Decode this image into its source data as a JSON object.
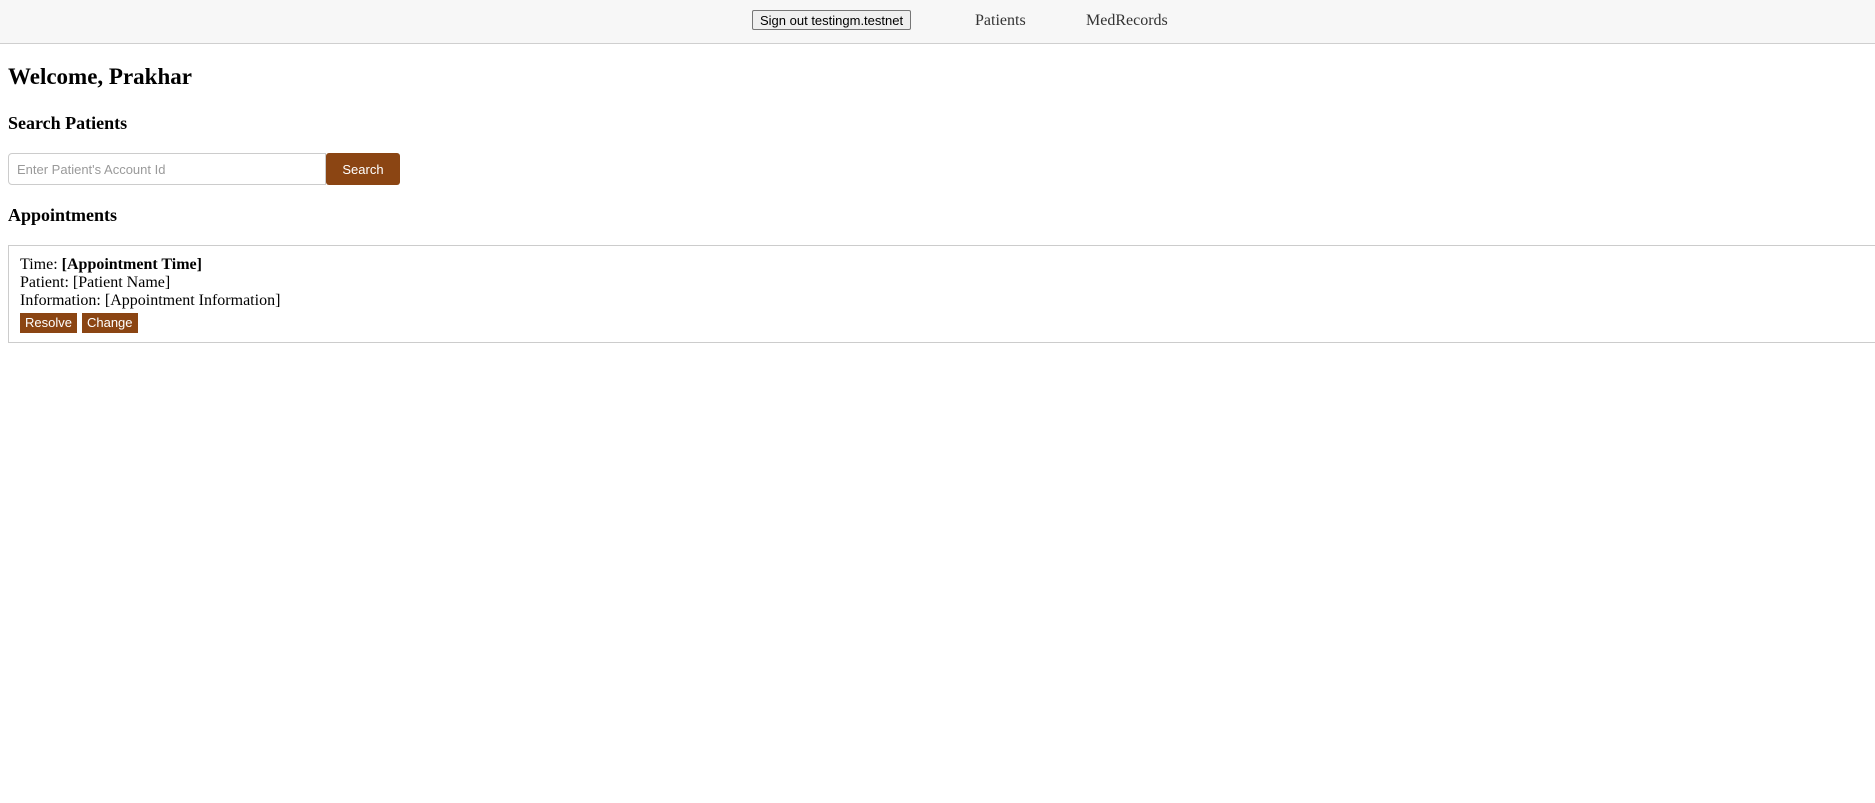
{
  "nav": {
    "signout_label": "Sign out testingm.testnet",
    "links": [
      {
        "label": "Patients"
      },
      {
        "label": "MedRecords"
      }
    ]
  },
  "main": {
    "welcome": "Welcome, Prakhar",
    "search_title": "Search Patients",
    "search": {
      "placeholder": "Enter Patient's Account Id",
      "value": "",
      "button_label": "Search"
    },
    "appointments_title": "Appointments",
    "appointments": [
      {
        "time_label": "Time: ",
        "time_value": "[Appointment Time]",
        "patient_label": "Patient: ",
        "patient_value": "[Patient Name]",
        "info_label": "Information: ",
        "info_value": "[Appointment Information]",
        "resolve_label": "Resolve",
        "change_label": "Change"
      }
    ]
  },
  "colors": {
    "accent": "#8b4513",
    "nav_background": "#f7f7f7"
  }
}
